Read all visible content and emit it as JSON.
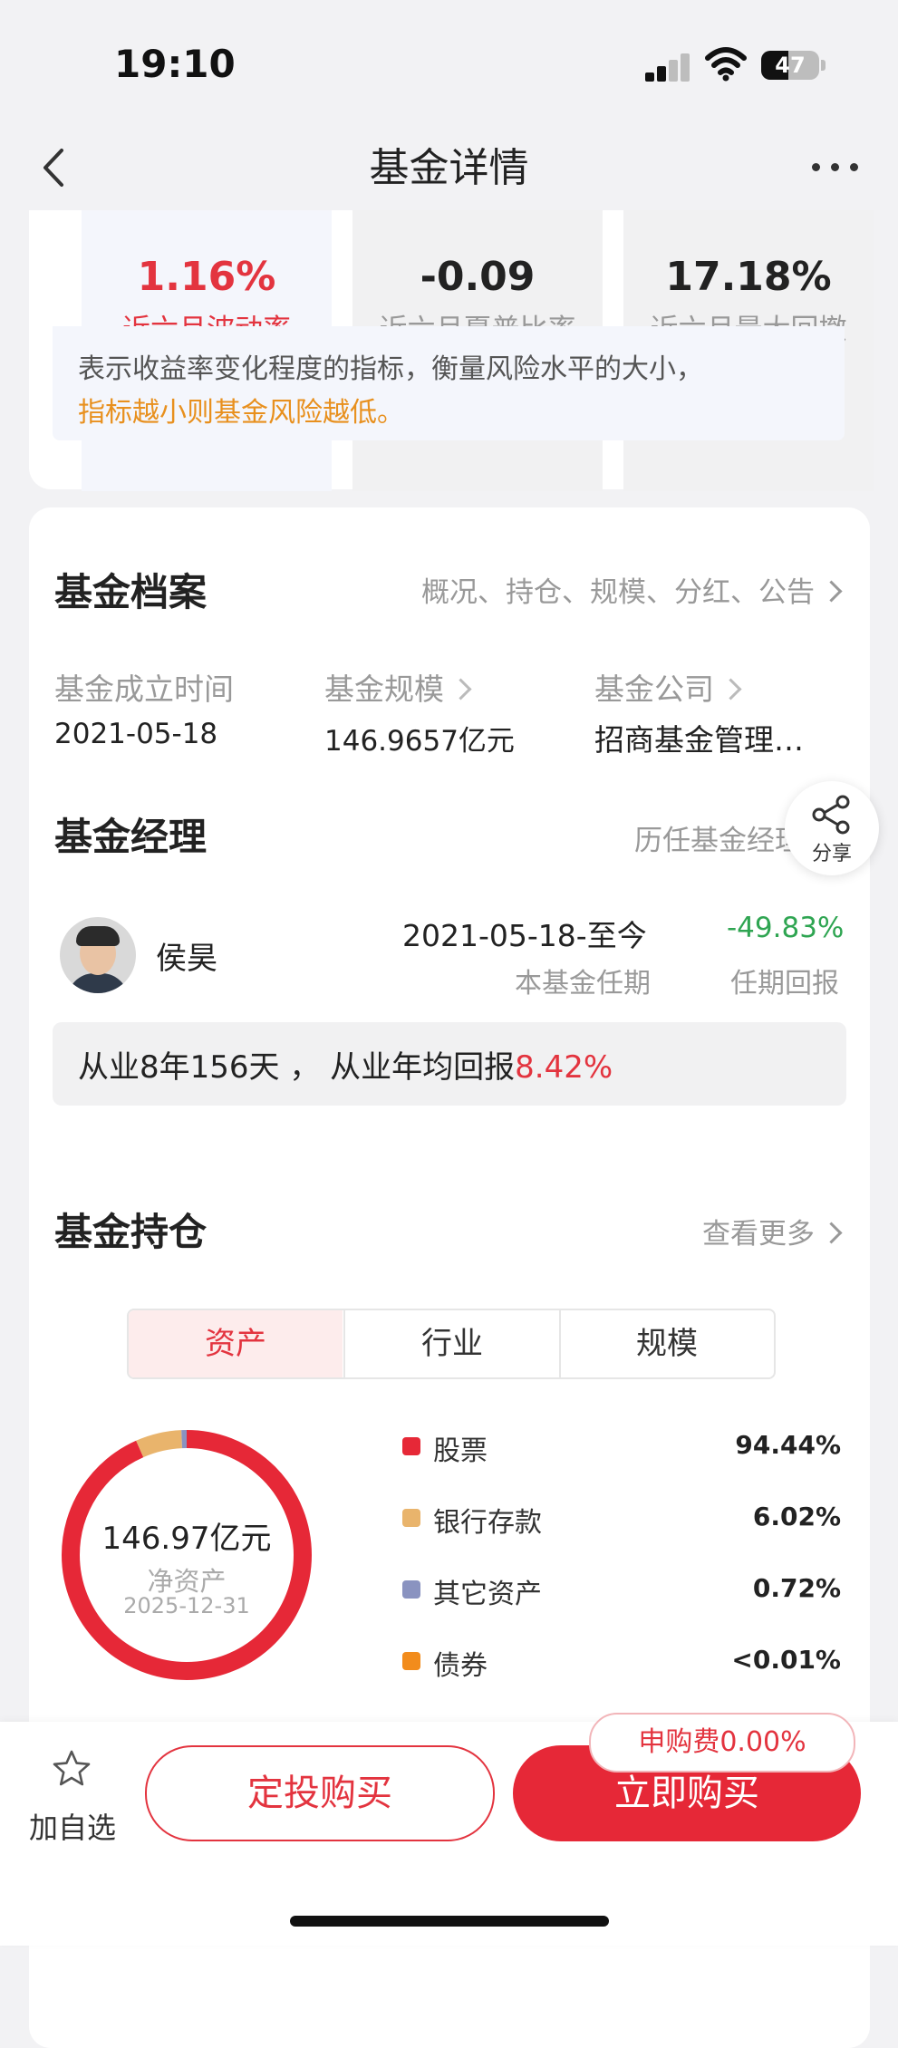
{
  "status_bar": {
    "time": "19:10",
    "battery": "47"
  },
  "nav": {
    "title": "基金详情"
  },
  "risk": {
    "metrics": [
      {
        "value": "1.16%",
        "label": "近六月波动率",
        "color": "#e3343f"
      },
      {
        "value": "-0.09",
        "label": "近六月夏普比率",
        "color": "#222222"
      },
      {
        "value": "17.18%",
        "label": "近六月最大回撤",
        "color": "#222222"
      }
    ],
    "desc_line1": "表示收益率变化程度的指标，衡量风险水平的大小，",
    "desc_line2": "指标越小则基金风险越低。"
  },
  "profile": {
    "title": "基金档案",
    "link": "概况、持仓、规模、分红、公告",
    "inception_label": "基金成立时间",
    "inception_value": "2021-05-18",
    "scale_label": "基金规模",
    "scale_value": "146.9657亿元",
    "company_label": "基金公司",
    "company_value": "招商基金管理…"
  },
  "manager": {
    "title": "基金经理",
    "history_link": "历任基金经理",
    "name": "侯昊",
    "tenure_period": "2021-05-18-至今",
    "tenure_period_label": "本基金任期",
    "tenure_return": "-49.83%",
    "tenure_return_label": "任期回报",
    "experience_prefix": "从业8年156天 ， 从业年均回报",
    "experience_return": "8.42%"
  },
  "holdings": {
    "title": "基金持仓",
    "more_link": "查看更多",
    "tabs": [
      "资产",
      "行业",
      "规模"
    ],
    "active_tab": "资产",
    "net_assets": "146.97亿元",
    "net_assets_label": "净资产",
    "date": "2025-12-31",
    "allocation": [
      {
        "name": "股票",
        "value": "94.44%",
        "percent": 94.44,
        "color": "#e62837"
      },
      {
        "name": "银行存款",
        "value": "6.02%",
        "percent": 6.02,
        "color": "#e9b46c"
      },
      {
        "name": "其它资产",
        "value": "0.72%",
        "percent": 0.72,
        "color": "#8a93c0"
      },
      {
        "name": "债券",
        "value": "<0.01%",
        "percent": 0.01,
        "color": "#f28c1c"
      }
    ]
  },
  "share": {
    "label": "分享"
  },
  "bottom": {
    "watch_label": "加自选",
    "dca_label": "定投购买",
    "buy_label": "立即购买",
    "fee_badge": "申购费0.00%"
  }
}
